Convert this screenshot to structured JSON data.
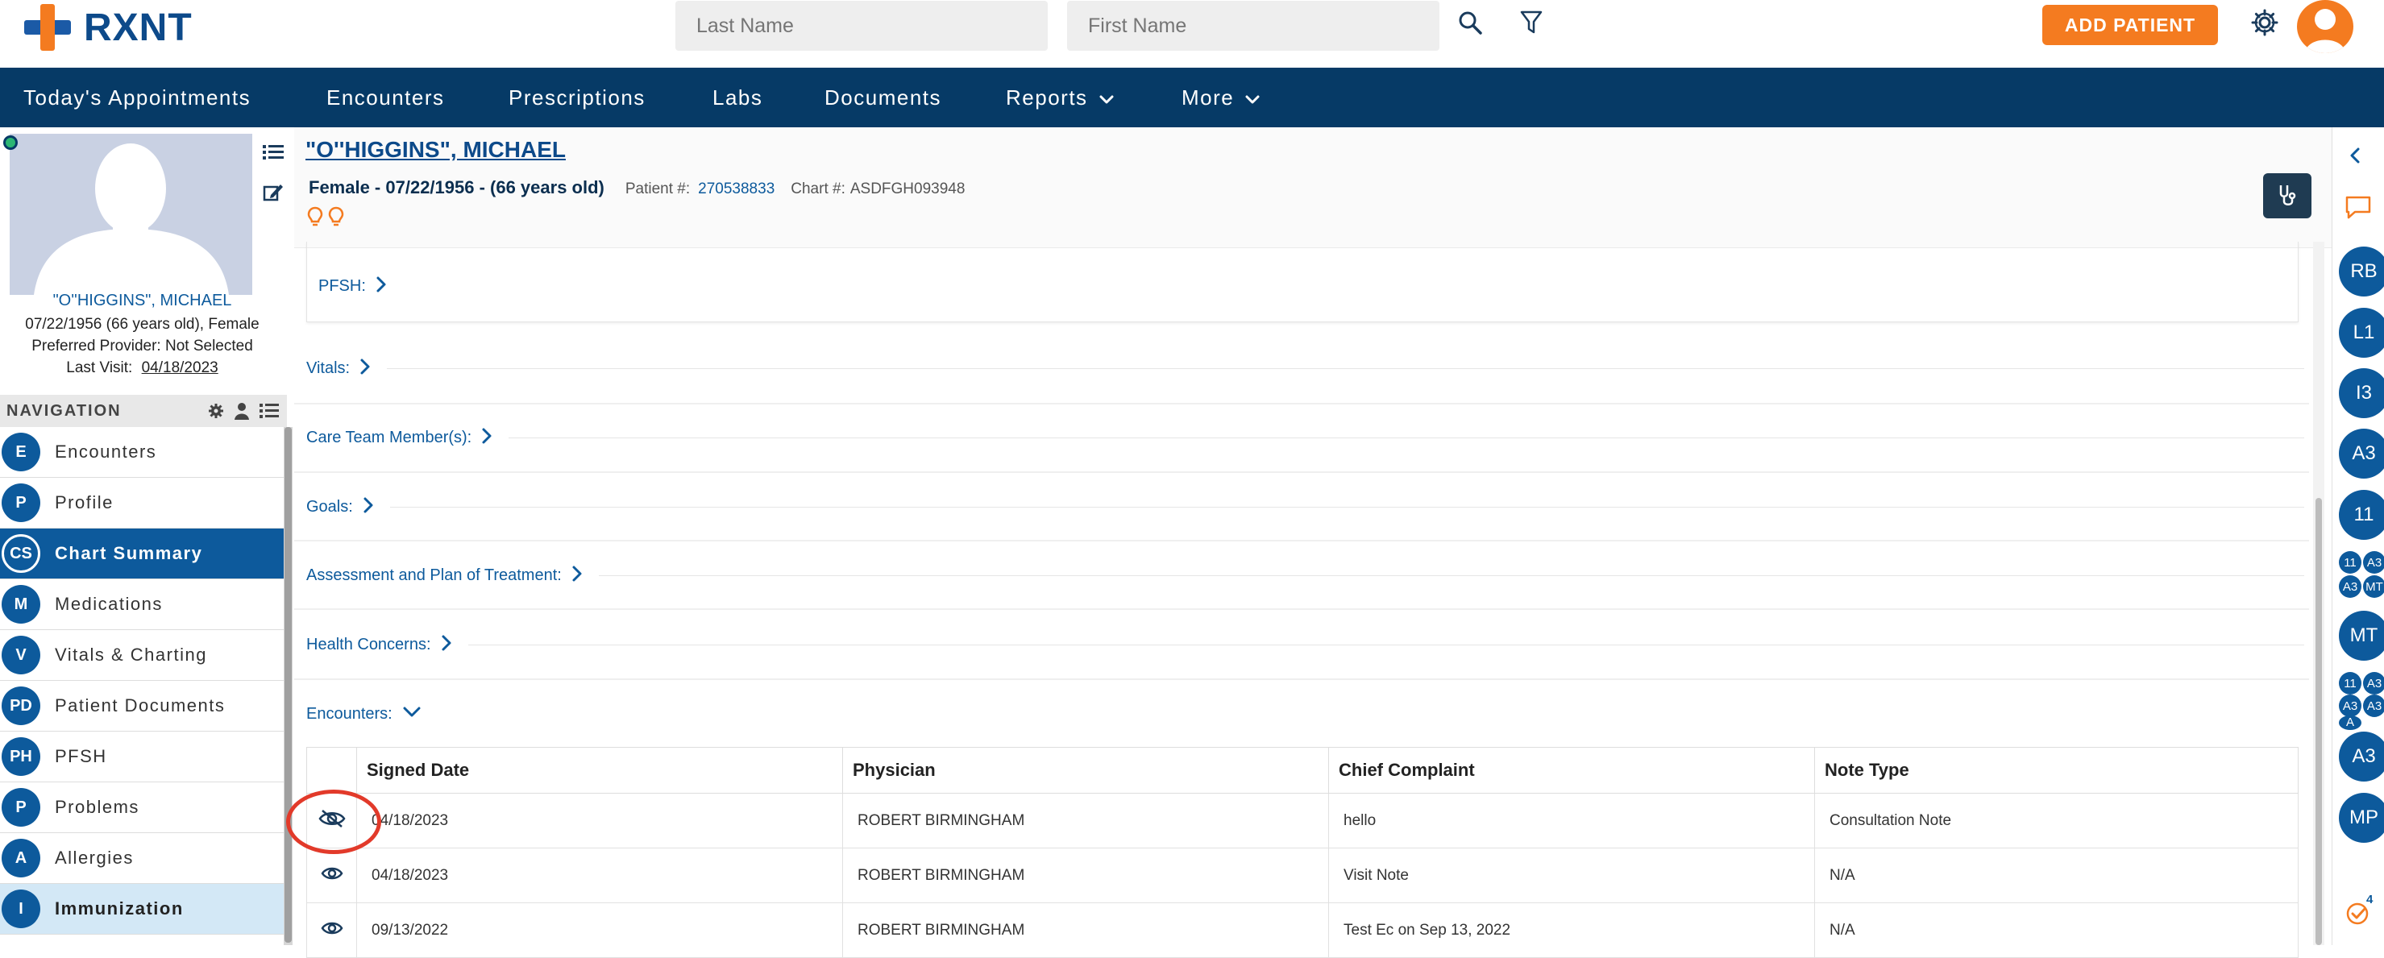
{
  "app": {
    "logo_text": "RXNT"
  },
  "header": {
    "last_name_placeholder": "Last Name",
    "first_name_placeholder": "First Name",
    "add_patient_label": "ADD PATIENT"
  },
  "nav": {
    "items": [
      {
        "label": "Today's Appointments"
      },
      {
        "label": "Encounters"
      },
      {
        "label": "Prescriptions"
      },
      {
        "label": "Labs"
      },
      {
        "label": "Documents"
      },
      {
        "label": "Reports"
      },
      {
        "label": "More"
      }
    ]
  },
  "patient_card": {
    "name": "\"O''HIGGINS\", MICHAEL",
    "dob_line": "07/22/1956 (66 years old), Female",
    "provider_line": "Preferred Provider: Not Selected",
    "last_visit_label": "Last Visit:",
    "last_visit_date": "04/18/2023"
  },
  "navigation": {
    "title": "NAVIGATION",
    "items": [
      {
        "badge": "E",
        "label": "Encounters"
      },
      {
        "badge": "P",
        "label": "Profile"
      },
      {
        "badge": "CS",
        "label": "Chart Summary"
      },
      {
        "badge": "M",
        "label": "Medications"
      },
      {
        "badge": "V",
        "label": "Vitals & Charting"
      },
      {
        "badge": "PD",
        "label": "Patient Documents"
      },
      {
        "badge": "PH",
        "label": "PFSH"
      },
      {
        "badge": "P",
        "label": "Problems"
      },
      {
        "badge": "A",
        "label": "Allergies"
      },
      {
        "badge": "I",
        "label": "Immunization"
      }
    ]
  },
  "patient_header": {
    "name": "\"O''HIGGINS\", MICHAEL",
    "demographics": "Female - 07/22/1956 - (66 years old)",
    "patient_num_label": "Patient #:",
    "patient_num": "270538833",
    "chart_num_label": "Chart #:",
    "chart_num": "ASDFGH093948"
  },
  "sections": [
    {
      "label": "PFSH:"
    },
    {
      "label": "Vitals:"
    },
    {
      "label": "Care Team Member(s):"
    },
    {
      "label": "Goals:"
    },
    {
      "label": "Assessment and Plan of Treatment:"
    },
    {
      "label": "Health Concerns:"
    },
    {
      "label": "Encounters:"
    }
  ],
  "encounters_table": {
    "columns": [
      "Signed Date",
      "Physician",
      "Chief Complaint",
      "Note Type"
    ],
    "rows": [
      {
        "date": "04/18/2023",
        "physician": "ROBERT BIRMINGHAM",
        "complaint": "hello",
        "note_type": "Consultation Note"
      },
      {
        "date": "04/18/2023",
        "physician": "ROBERT BIRMINGHAM",
        "complaint": "Visit Note",
        "note_type": "N/A"
      },
      {
        "date": "09/13/2022",
        "physician": "ROBERT BIRMINGHAM",
        "complaint": "Test Ec on Sep 13, 2022",
        "note_type": "N/A"
      }
    ]
  },
  "right_rail": {
    "badges": [
      "RB",
      "L1",
      "I3",
      "A3",
      "11",
      "MT",
      "A3",
      "MP"
    ],
    "mini_group_1": [
      "11",
      "A3",
      "A3",
      "MT"
    ],
    "mini_group_2": [
      "11",
      "A3",
      "A3",
      "A3",
      "A"
    ],
    "tasks_count": "4"
  },
  "colors": {
    "brand_navy": "#063a66",
    "accent_orange": "#f47b20",
    "link_blue": "#0d5a9c",
    "highlight_red": "#e23a2a"
  }
}
